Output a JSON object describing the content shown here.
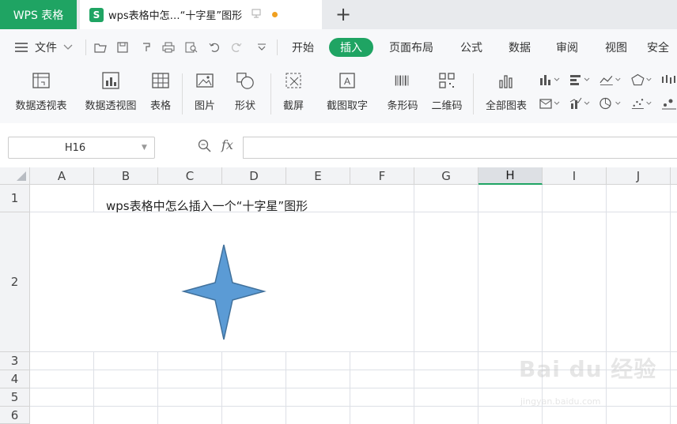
{
  "tabbar": {
    "app_tab": "WPS 表格",
    "doc_icon": "S",
    "doc_title": "wps表格中怎…“十字星”图形",
    "add_icon": "+"
  },
  "menubar": {
    "file_label": "文件",
    "tabs": [
      "开始",
      "插入",
      "页面布局",
      "公式",
      "数据",
      "审阅",
      "视图",
      "安全"
    ],
    "active_tab": "插入"
  },
  "ribbon": {
    "buttons": [
      "数据透视表",
      "数据透视图",
      "表格",
      "图片",
      "形状",
      "截屏",
      "截图取字",
      "条形码",
      "二维码",
      "全部图表"
    ]
  },
  "formula": {
    "cell_ref": "H16",
    "fx_label": "fx",
    "content": ""
  },
  "sheet": {
    "columns": [
      "A",
      "B",
      "C",
      "D",
      "E",
      "F",
      "G",
      "H",
      "I",
      "J"
    ],
    "selected_column": "H",
    "rows": [
      "1",
      "2",
      "3",
      "4",
      "5",
      "6"
    ],
    "cell_b1": "wps表格中怎么插入一个“十字星”图形",
    "shape_color": "#5b9bd5",
    "shape_outline": "#41719c",
    "shape_icon": "four-point-star-icon"
  },
  "colors": {
    "accent": "#1fa463",
    "dot": "#f0a020"
  },
  "watermark": {
    "text": "Bai du 经验",
    "sub": "jingyan.baidu.com"
  }
}
